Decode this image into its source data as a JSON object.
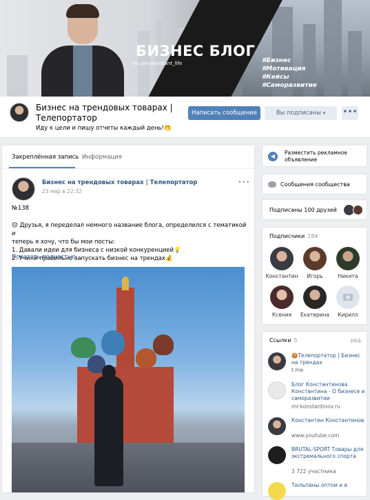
{
  "cover": {
    "title": "БИЗНЕС БЛОГ",
    "url": "vk.com/konstant_life",
    "tags": [
      "#Бизнес",
      "#Мотивация",
      "#Кейсы",
      "#Саморазвитие"
    ]
  },
  "profile": {
    "name": "Бизнес на трендовых товарах | Телепортатор",
    "status": "Иду к цели и пишу отчеты каждый день!🤭",
    "write_button": "Написать сообщение",
    "subscribed_button": "Вы подписаны",
    "more_button": "•••"
  },
  "wall": {
    "tabs": [
      "Закреплённая запись",
      "Информация"
    ],
    "post": {
      "author": "Бизнес на трендовых товарах | Телепортатор",
      "date": "23 мар в 22:32",
      "menu": "•••",
      "number": "№138",
      "lines": [
        "😔 Друзья, я переделал немного название блога, определился с тематикой и",
        "теперь я хочу, что бы мои посты:",
        "1. Давали идеи для бизнеса с низкой конкуренцией💡",
        "2. Учили правильно запускать бизнес на трендах💰"
      ],
      "show_more": "Показать полностью…"
    }
  },
  "sidebar": {
    "ad_label": "Разместить рекламное объявление",
    "messages_label": "Сообщения сообщества",
    "friends_label": "Подписаны 100 друзей",
    "subscribers": {
      "title": "Подписчики",
      "count": "184",
      "people": [
        {
          "name": "Константин",
          "color": "#3a3b40"
        },
        {
          "name": "Игорь",
          "color": "#5a3a2c"
        },
        {
          "name": "Никита",
          "color": "#2e3a2a"
        },
        {
          "name": "Ксения",
          "color": "#4a2b2b"
        },
        {
          "name": "Екатерина",
          "color": "#2a2624"
        },
        {
          "name": "Кирилл",
          "color": "#dfe5ec"
        }
      ]
    },
    "links": {
      "title": "Ссылки",
      "count": "5",
      "edit": "ред.",
      "items": [
        {
          "title": "🍪Телепортатор | Бизнес на трендах",
          "sub": "t.me",
          "color": "#3a3b40"
        },
        {
          "title": "Блог Константинова Константина - О бизнесе и саморазвитии",
          "sub": "mr-konstantinov.ru",
          "color": "#e9e9e9"
        },
        {
          "title": "Константин Константинов",
          "sub": "www.youtube.com",
          "color": "#3a3b40"
        },
        {
          "title": "BRUTAL-SPORT Товары для экстремального спорта",
          "sub": "3 722 участника",
          "color": "#1e1e1e"
        },
        {
          "title": "Тюльпаны оптом и в",
          "sub": "",
          "color": "#f3d94a"
        }
      ]
    }
  }
}
